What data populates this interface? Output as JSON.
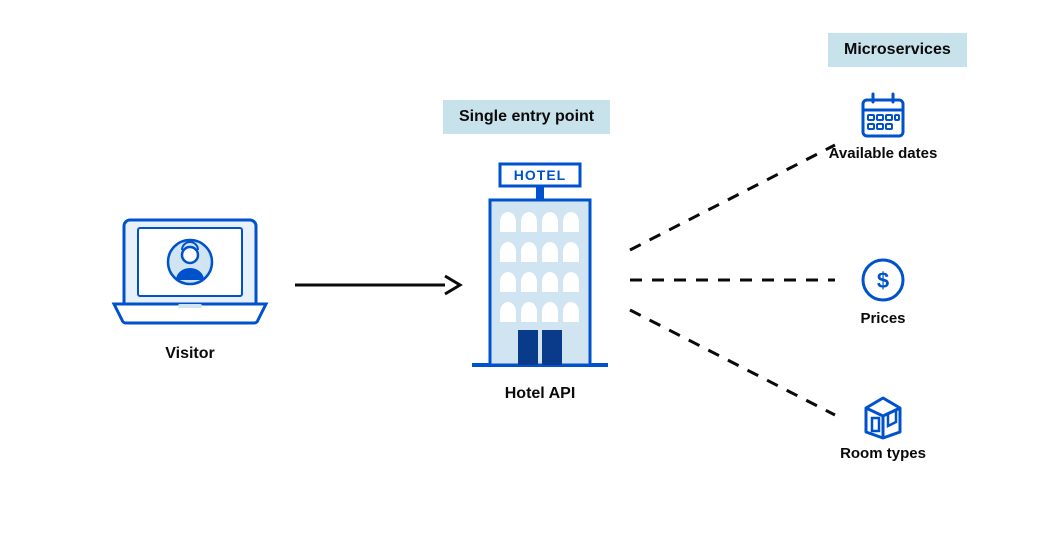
{
  "labels": {
    "single_entry_point": "Single entry point",
    "microservices": "Microservices"
  },
  "nodes": {
    "visitor": "Visitor",
    "hotel_api": "Hotel API",
    "hotel_sign": "HOTEL"
  },
  "microservices": {
    "available_dates": "Available dates",
    "prices": "Prices",
    "room_types": "Room types"
  },
  "colors": {
    "primary_blue": "#0052cc",
    "light_blue_fill": "#d1e4f2",
    "pale_blue": "#c8e2eb",
    "dark_blue": "#0a3a8a",
    "dashed": "#0a0a0a"
  }
}
